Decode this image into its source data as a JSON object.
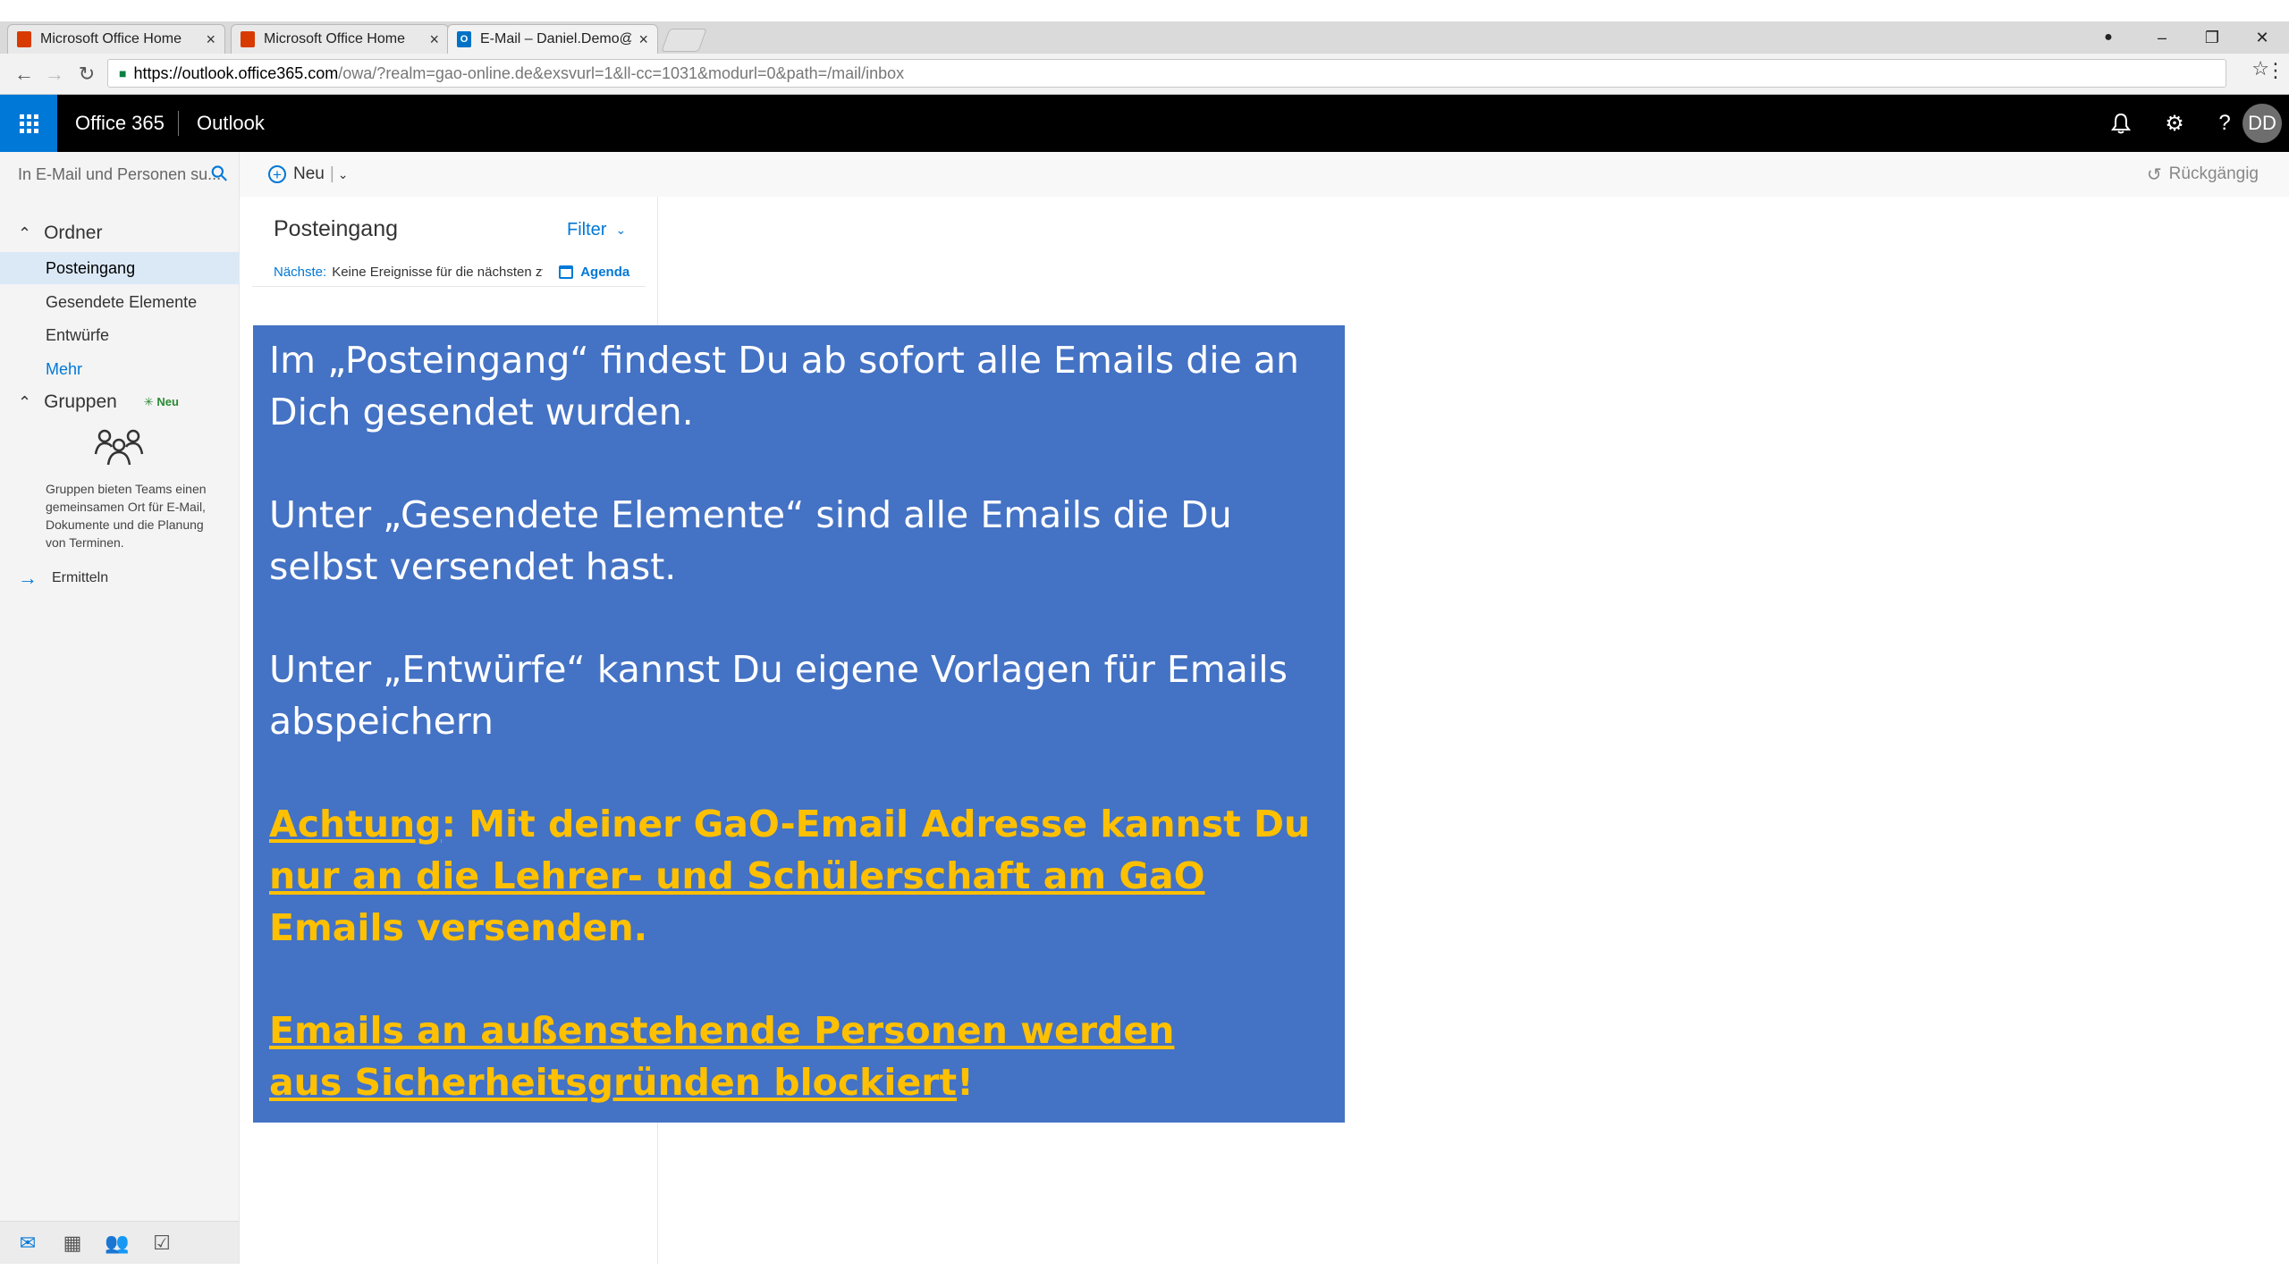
{
  "browser": {
    "tabs": [
      {
        "title": "Microsoft Office Home",
        "icon": "office-icon"
      },
      {
        "title": "Microsoft Office Home",
        "icon": "office-icon"
      },
      {
        "title": "E-Mail – Daniel.Demo@g",
        "icon": "outlook-icon"
      }
    ],
    "url_host": "https://outlook.office365.com",
    "url_path": "/owa/?realm=gao-online.de&exsvurl=1&ll-cc=1031&modurl=0&path=/mail/inbox"
  },
  "header": {
    "brand": "Office 365",
    "app": "Outlook",
    "avatar_initials": "DD",
    "colors": {
      "bar": "#000000",
      "waffle": "#0078d7"
    }
  },
  "toolbar": {
    "search_placeholder": "In E-Mail und Personen su...",
    "new_label": "Neu",
    "undo_label": "Rückgängig"
  },
  "leftnav": {
    "folders_heading": "Ordner",
    "folders": [
      "Posteingang",
      "Gesendete Elemente",
      "Entwürfe"
    ],
    "more": "Mehr",
    "groups_heading": "Gruppen",
    "groups_badge": "Neu",
    "groups_desc": "Gruppen bieten Teams einen gemeinsamen Ort für E-Mail, Dokumente und die Planung von Terminen.",
    "discover": "Ermitteln"
  },
  "msglist": {
    "title": "Posteingang",
    "filter": "Filter",
    "next_label": "Nächste:",
    "next_text": "Keine Ereignisse für die nächsten zw",
    "agenda": "Agenda"
  },
  "overlay": {
    "p1": "Im „Posteingang“ findest Du ab sofort alle Emails die an Dich gesendet wurden.",
    "p2": "Unter „Gesendete Elemente“ sind alle Emails die Du selbst versendet hast.",
    "p3": "Unter „Entwürfe“ kannst Du eigene Vorlagen für Emails abspeichern",
    "warn1_a": "Achtung",
    "warn1_b": ": Mit deiner GaO-Email Adresse kannst Du",
    "warn1_c": "nur an die Lehrer- und Schülerschaft am GaO",
    "warn1_d": " Emails versenden.",
    "warn2_a": "Emails an außenstehende Personen werden",
    "warn2_b": "aus Sicherheitsgründen blockiert",
    "warn2_c": "!",
    "colors": {
      "background": "#4472c4",
      "text": "#ffffff",
      "warning": "#ffc000"
    }
  }
}
